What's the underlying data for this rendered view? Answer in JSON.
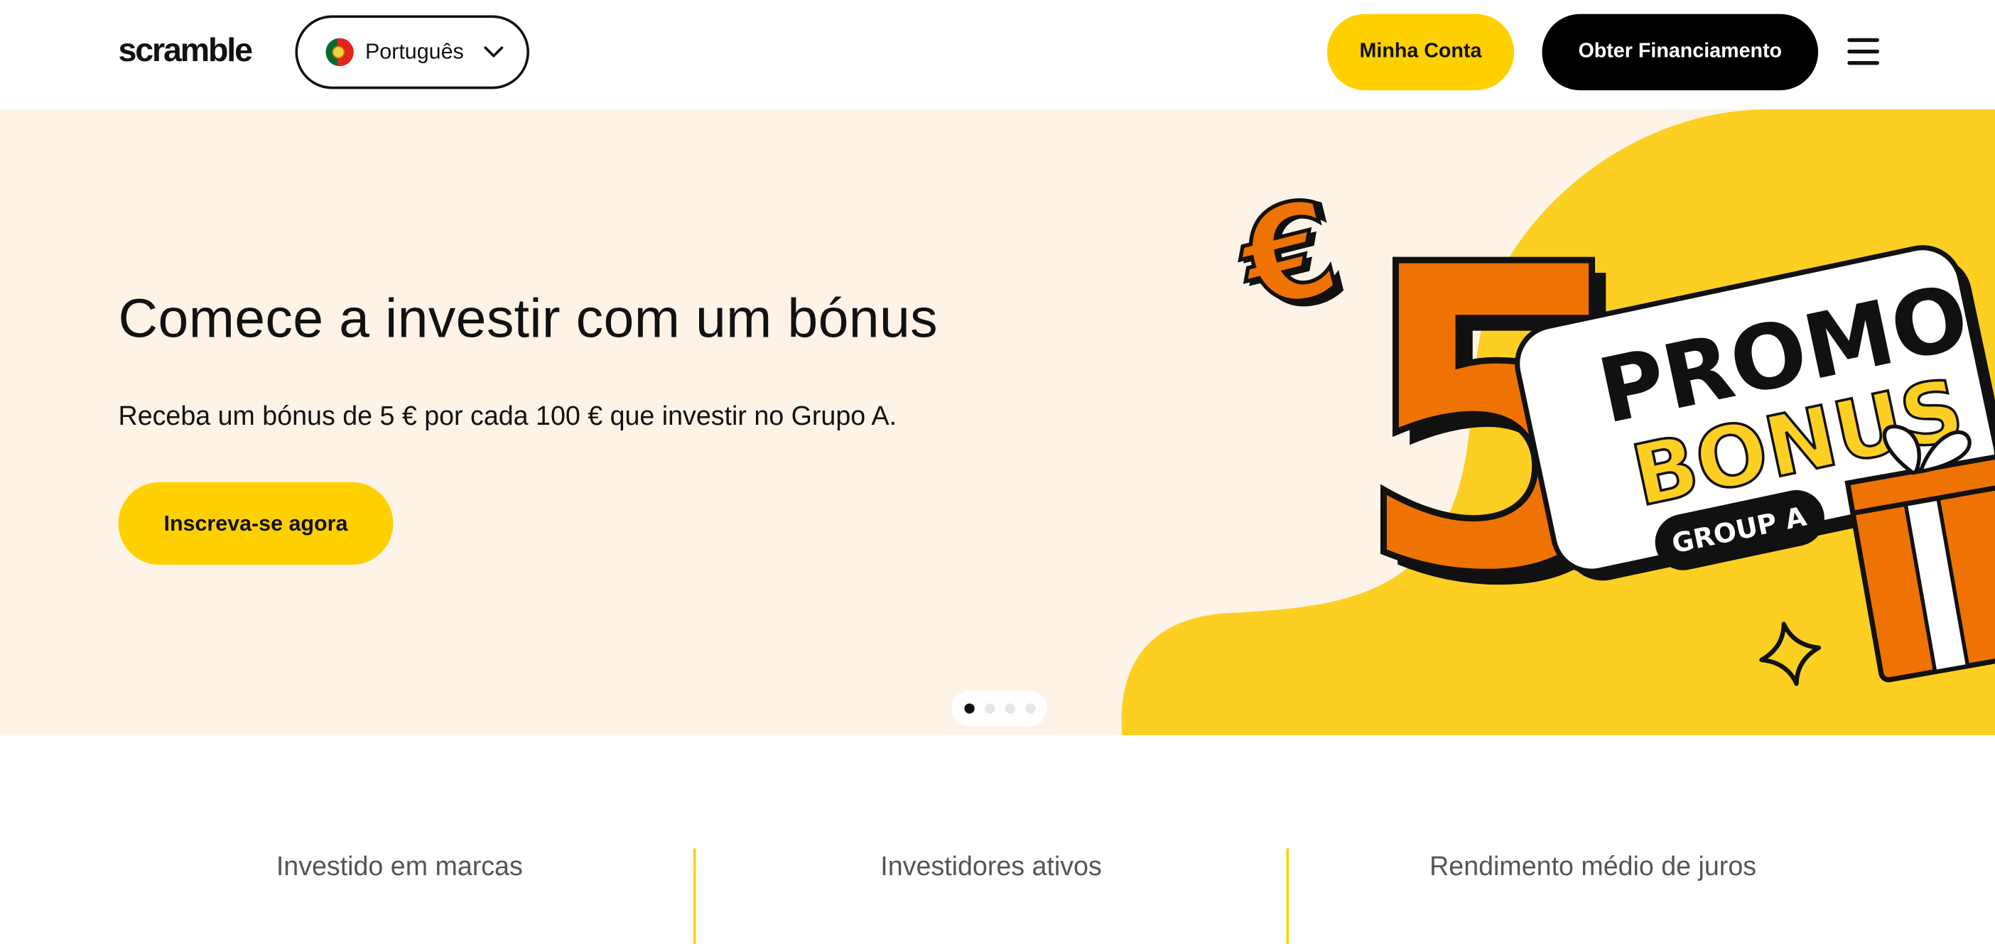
{
  "header": {
    "logo": "scramble",
    "language": {
      "label": "Português"
    },
    "account_label": "Minha Conta",
    "funding_label": "Obter Financiamento"
  },
  "hero": {
    "title": "Comece a investir com um bónus",
    "subtitle": "Receba um bónus de 5 € por cada 100 € que investir no Grupo A.",
    "cta_label": "Inscreva-se agora",
    "promo": {
      "euro_symbol": "€",
      "amount": "5",
      "line1": "PROMO",
      "line2": "BONUS",
      "group": "GROUP A"
    },
    "carousel": {
      "slides": 4,
      "active_index": 1
    }
  },
  "stats": [
    {
      "label": "Investido em marcas"
    },
    {
      "label": "Investidores ativos"
    },
    {
      "label": "Rendimento médio de juros"
    }
  ],
  "colors": {
    "accent": "#ffd000",
    "hero_bg": "#fdf3e7",
    "promo_orange": "#ee7303",
    "promo_yellow": "#fccf22",
    "dark": "#000000"
  }
}
